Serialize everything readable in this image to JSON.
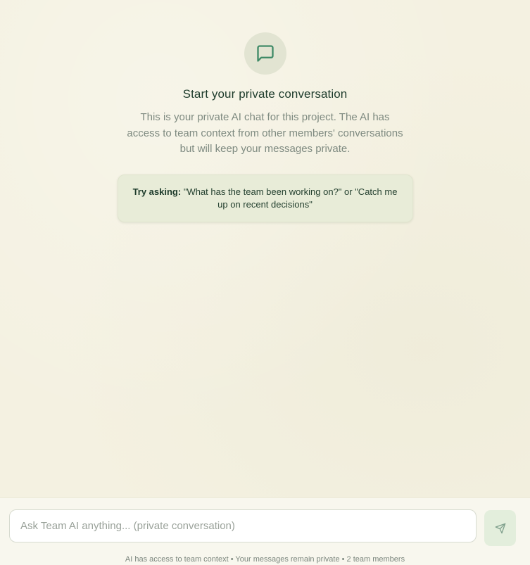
{
  "empty_state": {
    "icon": "message-square-icon",
    "title": "Start your private conversation",
    "description": "This is your private AI chat for this project. The AI has access to team context from other members' conversations but will keep your messages private.",
    "suggestion": {
      "label": "Try asking:",
      "text": "\"What has the team been working on?\" or \"Catch me up on recent decisions\""
    }
  },
  "composer": {
    "placeholder": "Ask Team AI anything... (private conversation)",
    "value": "",
    "send_icon": "send-icon",
    "footer": "AI has access to team context • Your messages remain private • 2 team members"
  },
  "colors": {
    "background": "#f4f1e1",
    "accent": "#3f8a67",
    "title": "#1d3b2b",
    "muted_text": "#7e8a80",
    "suggestion_bg": "#e8ecd8",
    "send_button_bg": "#e3eedc"
  }
}
